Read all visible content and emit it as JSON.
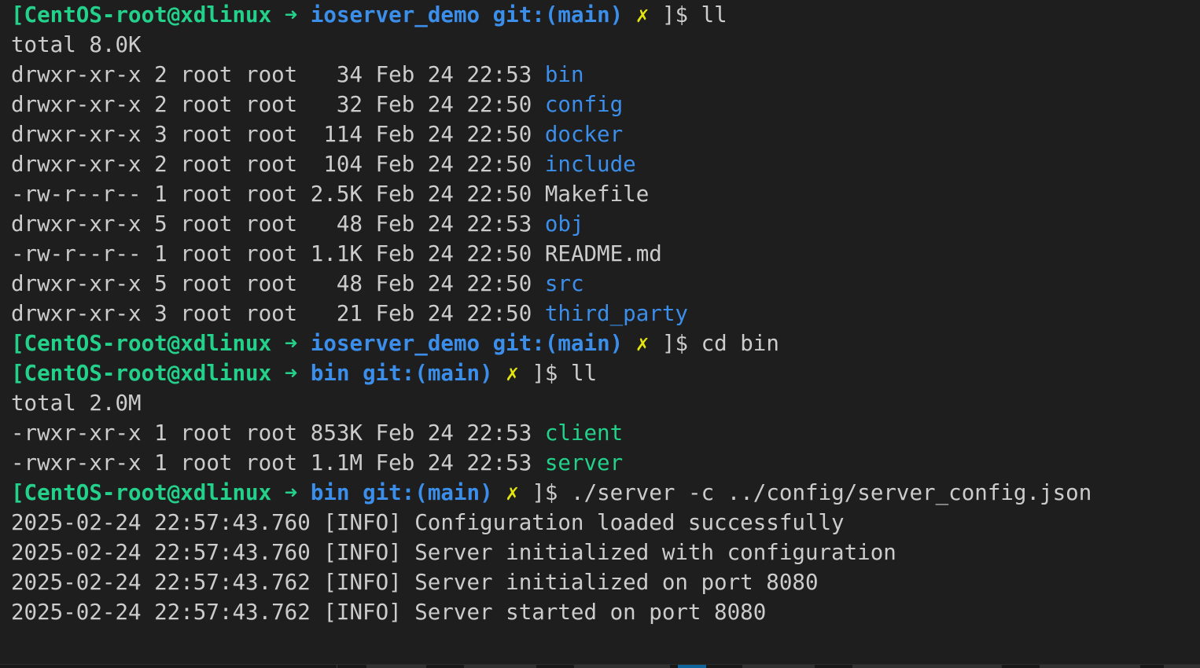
{
  "terminal": {
    "lines": [
      {
        "type": "prompt",
        "host": "[CentOS-root@xdlinux",
        "arrow": "➜",
        "dir": "ioserver_demo",
        "git": "git:(main)",
        "mark": "✗",
        "end": "]$",
        "command": "ll"
      },
      {
        "type": "output",
        "text": "total 8.0K"
      },
      {
        "type": "ls",
        "meta": "drwxr-xr-x 2 root root   34 Feb 24 22:53",
        "name": "bin",
        "color": "blue"
      },
      {
        "type": "ls",
        "meta": "drwxr-xr-x 2 root root   32 Feb 24 22:50",
        "name": "config",
        "color": "blue"
      },
      {
        "type": "ls",
        "meta": "drwxr-xr-x 3 root root  114 Feb 24 22:50",
        "name": "docker",
        "color": "blue"
      },
      {
        "type": "ls",
        "meta": "drwxr-xr-x 2 root root  104 Feb 24 22:50",
        "name": "include",
        "color": "blue"
      },
      {
        "type": "ls",
        "meta": "-rw-r--r-- 1 root root 2.5K Feb 24 22:50",
        "name": "Makefile",
        "color": "plain"
      },
      {
        "type": "ls",
        "meta": "drwxr-xr-x 5 root root   48 Feb 24 22:53",
        "name": "obj",
        "color": "blue"
      },
      {
        "type": "ls",
        "meta": "-rw-r--r-- 1 root root 1.1K Feb 24 22:50",
        "name": "README.md",
        "color": "plain"
      },
      {
        "type": "ls",
        "meta": "drwxr-xr-x 5 root root   48 Feb 24 22:50",
        "name": "src",
        "color": "blue"
      },
      {
        "type": "ls",
        "meta": "drwxr-xr-x 3 root root   21 Feb 24 22:50",
        "name": "third_party",
        "color": "blue"
      },
      {
        "type": "prompt",
        "host": "[CentOS-root@xdlinux",
        "arrow": "➜",
        "dir": "ioserver_demo",
        "git": "git:(main)",
        "mark": "✗",
        "end": "]$",
        "command": "cd bin"
      },
      {
        "type": "prompt",
        "host": "[CentOS-root@xdlinux",
        "arrow": "➜",
        "dir": "bin",
        "git": "git:(main)",
        "mark": "✗",
        "end": "]$",
        "command": "ll"
      },
      {
        "type": "output",
        "text": "total 2.0M"
      },
      {
        "type": "ls",
        "meta": "-rwxr-xr-x 1 root root 853K Feb 24 22:53",
        "name": "client",
        "color": "green"
      },
      {
        "type": "ls",
        "meta": "-rwxr-xr-x 1 root root 1.1M Feb 24 22:53",
        "name": "server",
        "color": "green"
      },
      {
        "type": "prompt",
        "host": "[CentOS-root@xdlinux",
        "arrow": "➜",
        "dir": "bin",
        "git": "git:(main)",
        "mark": "✗",
        "end": "]$",
        "command": "./server -c ../config/server_config.json"
      },
      {
        "type": "output",
        "text": "2025-02-24 22:57:43.760 [INFO] Configuration loaded successfully"
      },
      {
        "type": "output",
        "text": "2025-02-24 22:57:43.760 [INFO] Server initialized with configuration"
      },
      {
        "type": "output",
        "text": "2025-02-24 22:57:43.762 [INFO] Server initialized on port 8080"
      },
      {
        "type": "output",
        "text": "2025-02-24 22:57:43.762 [INFO] Server started on port 8080"
      }
    ]
  },
  "colors": {
    "background": "#1e1e1e",
    "text": "#cccccc",
    "prompt_host": "#23d18b",
    "directory": "#3b8eea",
    "executable": "#23d18b",
    "git_dirty_mark": "#e5e510"
  }
}
